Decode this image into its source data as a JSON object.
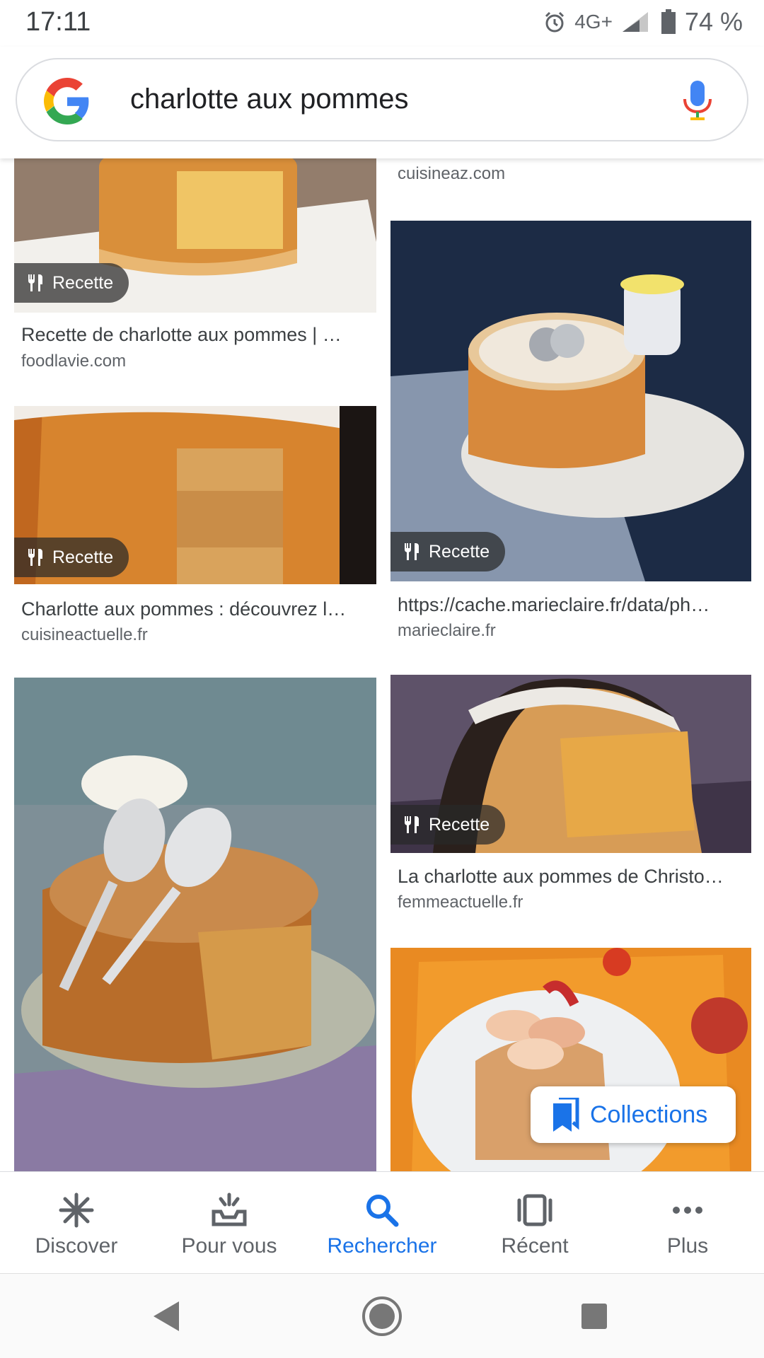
{
  "status_bar": {
    "time": "17:11",
    "network": "4G+",
    "battery": "74 %"
  },
  "search": {
    "query": "charlotte aux pommes"
  },
  "results": [
    {
      "title": "Recette de charlotte aux pommes | …",
      "domain": "foodlavie.com",
      "chip": "Recette"
    },
    {
      "title": "",
      "domain": "cuisineaz.com",
      "chip": ""
    },
    {
      "title": "https://cache.marieclaire.fr/data/ph…",
      "domain": "marieclaire.fr",
      "chip": "Recette"
    },
    {
      "title": "Charlotte aux pommes : découvrez l…",
      "domain": "cuisineactuelle.fr",
      "chip": "Recette"
    },
    {
      "title": "La charlotte aux pommes de Christo…",
      "domain": "femmeactuelle.fr",
      "chip": "Recette"
    }
  ],
  "collections_label": "Collections",
  "bottom_nav": [
    {
      "label": "Discover",
      "icon": "discover-icon"
    },
    {
      "label": "Pour vous",
      "icon": "pour-vous-icon"
    },
    {
      "label": "Rechercher",
      "icon": "search-icon"
    },
    {
      "label": "Récent",
      "icon": "recent-icon"
    },
    {
      "label": "Plus",
      "icon": "more-icon"
    }
  ],
  "colors": {
    "accent": "#1a73e8",
    "text_primary": "#3c4043",
    "text_secondary": "#5f6368"
  }
}
